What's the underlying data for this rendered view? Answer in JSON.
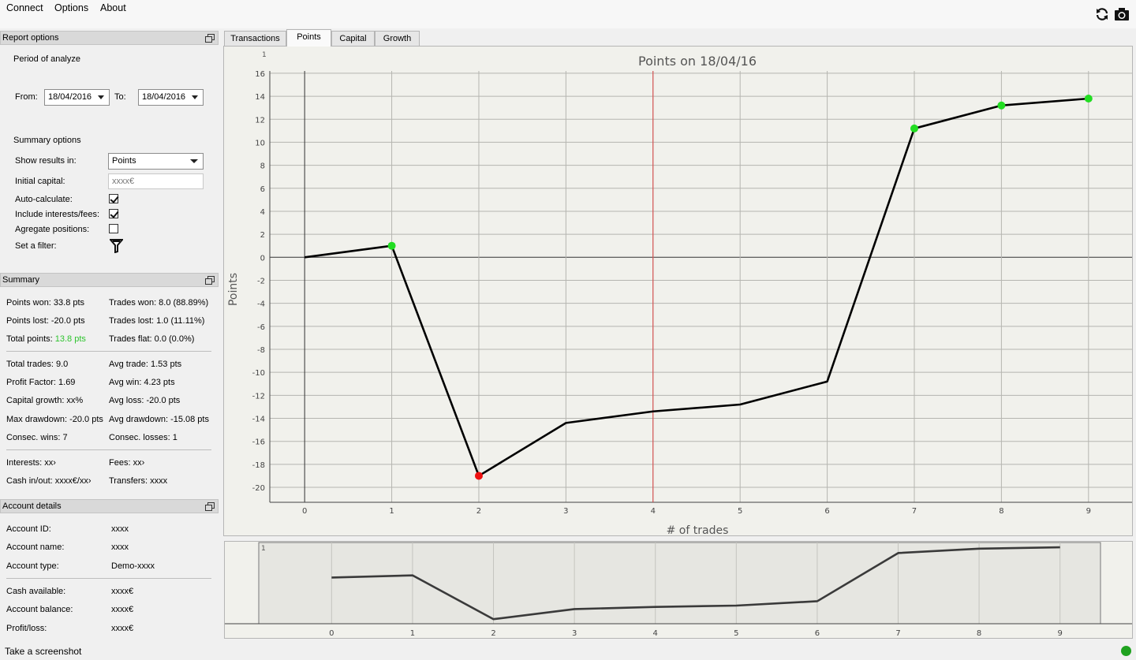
{
  "menu": {
    "connect": "Connect",
    "options": "Options",
    "about": "About"
  },
  "toolbar": {
    "refresh_icon": "refresh-icon",
    "camera_icon": "camera-icon"
  },
  "report_options": {
    "title": "Report options",
    "period_label": "Period of analyze",
    "from_label": "From:",
    "from_value": "18/04/2016",
    "to_label": "To:",
    "to_value": "18/04/2016",
    "summary_options_label": "Summary options",
    "show_results_label": "Show results in:",
    "show_results_value": "Points",
    "initial_capital_label": "Initial capital:",
    "initial_capital_placeholder": "xxxx€",
    "auto_calculate_label": "Auto-calculate:",
    "auto_calculate_checked": true,
    "include_interests_label": "Include interests/fees:",
    "include_interests_checked": true,
    "aggregate_label": "Agregate positions:",
    "aggregate_checked": false,
    "filter_label": "Set a filter:"
  },
  "summary": {
    "title": "Summary",
    "points_won": "Points won: 33.8 pts",
    "trades_won": "Trades won: 8.0 (88.89%)",
    "points_lost": "Points lost: -20.0 pts",
    "trades_lost": "Trades lost: 1.0 (11.11%)",
    "total_points_label": "Total points: ",
    "total_points_value": "13.8 pts",
    "total_points_color": "#2ec42e",
    "trades_flat": "Trades flat: 0.0 (0.0%)",
    "total_trades": "Total trades: 9.0",
    "avg_trade": "Avg trade: 1.53 pts",
    "profit_factor": "Profit Factor: 1.69",
    "avg_win": "Avg win: 4.23 pts",
    "capital_growth": "Capital growth: xx%",
    "avg_loss": "Avg loss: -20.0 pts",
    "max_drawdown": "Max drawdown: -20.0 pts",
    "avg_drawdown": "Avg drawdown: -15.08 pts",
    "consec_wins": "Consec. wins: 7",
    "consec_losses": "Consec. losses: 1",
    "interests": "Interests: xx›",
    "fees": "Fees: xx›",
    "cash_in_out": "Cash in/out: xxxx€/xx›",
    "transfers": "Transfers: xxxx"
  },
  "account": {
    "title": "Account details",
    "rows": [
      {
        "label": "Account ID:",
        "value": "xxxx"
      },
      {
        "label": "Account name:",
        "value": "xxxx"
      },
      {
        "label": "Account type:",
        "value": "Demo-xxxx"
      },
      {
        "label": "Cash available:",
        "value": "xxxx€"
      },
      {
        "label": "Account balance:",
        "value": "xxxx€"
      },
      {
        "label": "Profit/loss:",
        "value": "xxxx€"
      }
    ]
  },
  "tabs": [
    {
      "label": "Transactions",
      "active": false
    },
    {
      "label": "Points",
      "active": true
    },
    {
      "label": "Capital",
      "active": false
    },
    {
      "label": "Growth",
      "active": false
    }
  ],
  "status": {
    "text": "Take a screenshot",
    "indicator_color": "#1fa21f"
  },
  "chart_data": {
    "type": "line",
    "title": "Points on 18/04/16",
    "xlabel": "# of trades",
    "ylabel": "Points",
    "corner_label": "1",
    "x": [
      0,
      1,
      2,
      3,
      4,
      5,
      6,
      7,
      8,
      9
    ],
    "y": [
      0.0,
      1.0,
      -19.0,
      -14.4,
      -13.4,
      -12.8,
      -10.8,
      11.2,
      13.2,
      13.8
    ],
    "marker_colors": [
      null,
      "#22dd22",
      "#ee1111",
      null,
      null,
      null,
      null,
      "#22dd22",
      "#22dd22",
      "#22dd22"
    ],
    "xlim": [
      -0.4,
      9.5
    ],
    "ylim": [
      -21.3,
      16.2
    ],
    "xticks": [
      "0",
      "1",
      "2",
      "3",
      "4",
      "5",
      "6",
      "7",
      "8",
      "9"
    ],
    "yticks": [
      "16",
      "14",
      "12",
      "10",
      "8",
      "6",
      "4",
      "2",
      "0",
      "-2",
      "-4",
      "-6",
      "-8",
      "-10",
      "-12",
      "-14",
      "-16",
      "-18",
      "-20"
    ],
    "vline_x": 4,
    "vline_color": "#d94040",
    "grid": true
  },
  "mini_chart": {
    "corner_label": "1"
  }
}
